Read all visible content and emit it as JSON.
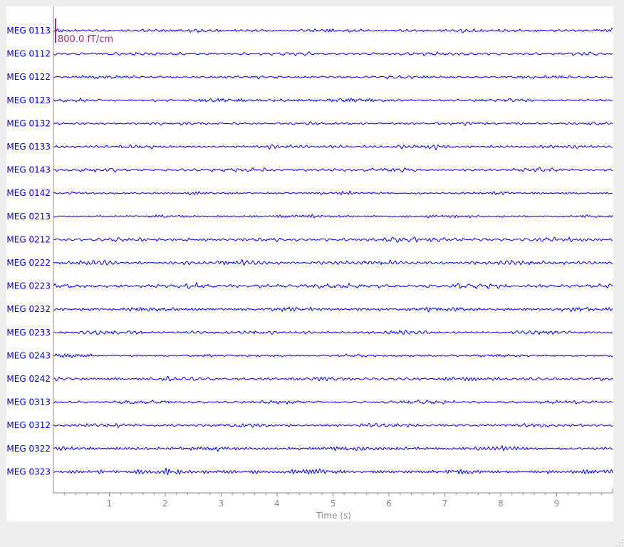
{
  "colors": {
    "trace": "#0000e6",
    "channel_label": "#0000cc",
    "scalebar": "#a0306e",
    "axis": "#8a8a8a",
    "background": "#ffffff",
    "window_bg": "#efefef"
  },
  "chart_data": {
    "type": "line",
    "xlabel": "Time (s)",
    "xlim": [
      0,
      10
    ],
    "xticks": [
      1,
      2,
      3,
      4,
      5,
      6,
      7,
      8,
      9
    ],
    "xtick_labels": [
      "1",
      "2",
      "3",
      "4",
      "5",
      "6",
      "7",
      "8",
      "9"
    ],
    "minor_tick_step": 0.2,
    "channels": [
      "MEG 0113",
      "MEG 0112",
      "MEG 0122",
      "MEG 0123",
      "MEG 0132",
      "MEG 0133",
      "MEG 0143",
      "MEG 0142",
      "MEG 0213",
      "MEG 0212",
      "MEG 0222",
      "MEG 0223",
      "MEG 0232",
      "MEG 0233",
      "MEG 0243",
      "MEG 0242",
      "MEG 0313",
      "MEG 0312",
      "MEG 0322",
      "MEG 0323"
    ],
    "channel_amplitude_ft_cm": [
      110,
      100,
      110,
      110,
      100,
      120,
      115,
      110,
      120,
      125,
      150,
      145,
      135,
      115,
      115,
      120,
      125,
      130,
      150,
      170
    ],
    "scalebar": {
      "label": "800.0 fT/cm",
      "value_ft_cm": 800
    },
    "grid": false,
    "legend": "none"
  }
}
